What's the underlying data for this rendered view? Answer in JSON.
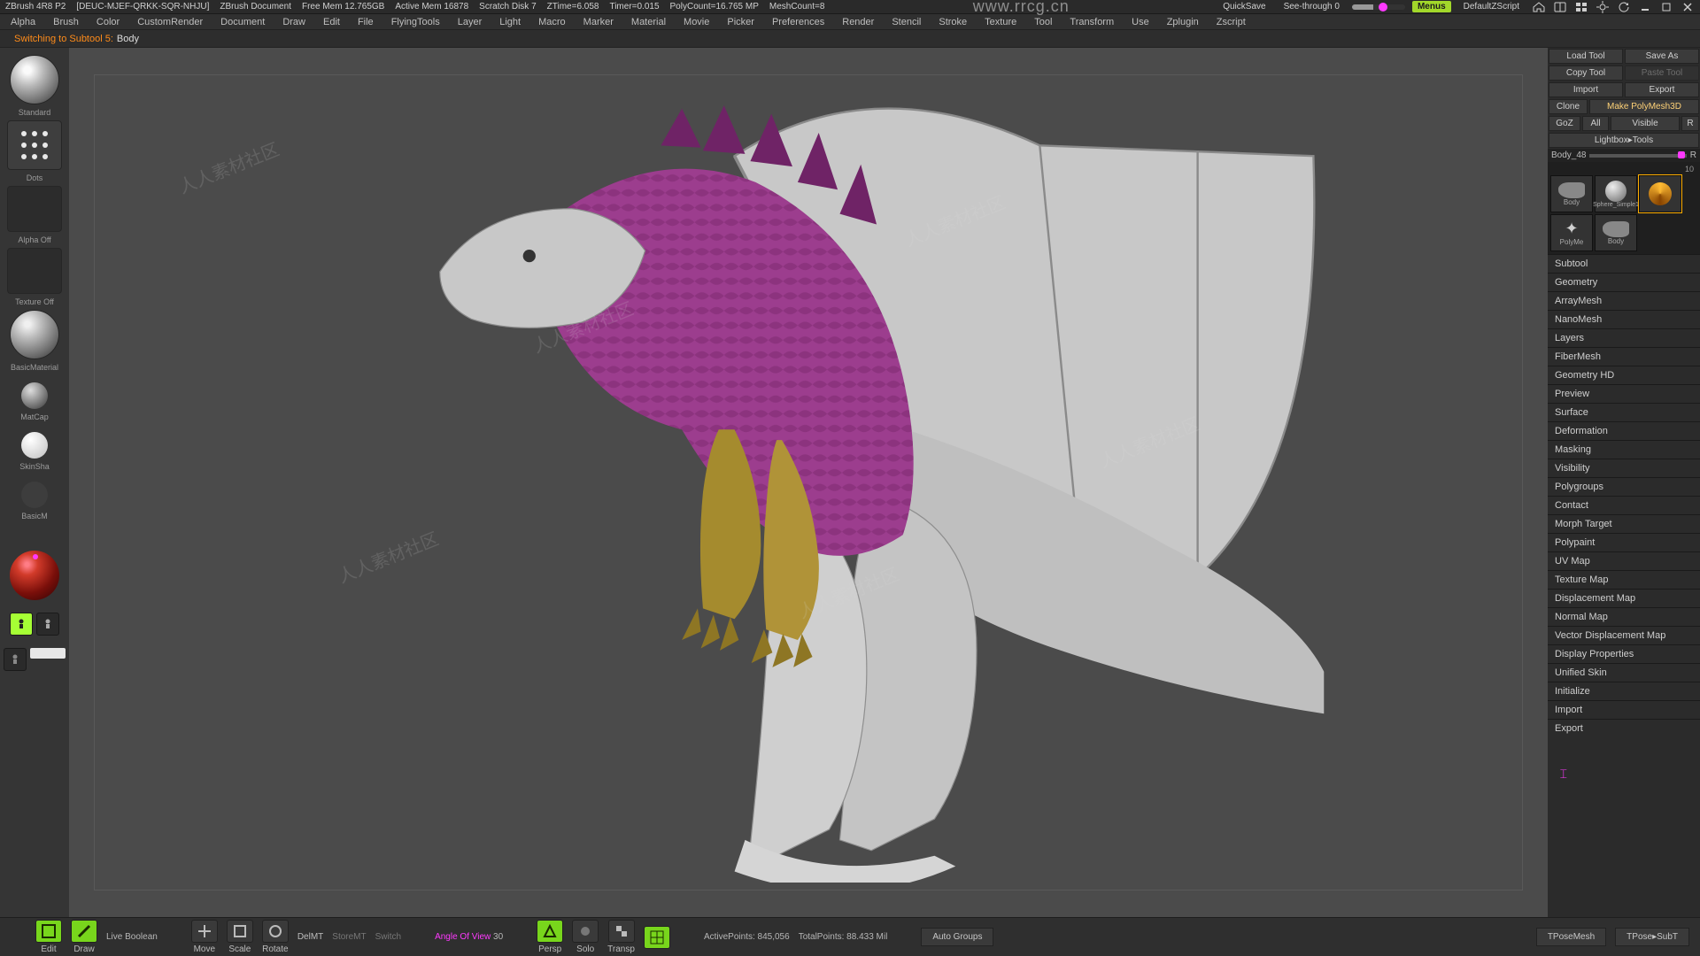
{
  "titlebar": {
    "app": "ZBrush 4R8 P2",
    "docid": "[DEUC-MJEF-QRKK-SQR-NHJU]",
    "doclabel": "ZBrush Document",
    "freemem": "Free Mem 12.765GB",
    "activemem": "Active Mem 16878",
    "scratch": "Scratch Disk 7",
    "ztime": "ZTime=6.058",
    "timer": "Timer=0.015",
    "polycount": "PolyCount=16.765 MP",
    "meshcount": "MeshCount=8",
    "watermark": "www.rrcg.cn",
    "quicksave": "QuickSave",
    "seethrough": "See-through  0",
    "menus": "Menus",
    "defaultz": "DefaultZScript"
  },
  "menus": {
    "items": [
      "Alpha",
      "Brush",
      "Color",
      "CustomRender",
      "Document",
      "Draw",
      "Edit",
      "File",
      "FlyingTools",
      "Layer",
      "Light",
      "Macro",
      "Marker",
      "Material",
      "Movie",
      "Picker",
      "Preferences",
      "Render",
      "Stencil",
      "Stroke",
      "Texture",
      "Tool",
      "Transform",
      "Use",
      "Zplugin",
      "Zscript"
    ]
  },
  "inforow": {
    "label": "Switching to Subtool 5:",
    "value": "Body"
  },
  "leftbar": {
    "brush_label": "Standard",
    "stroke_label": "Dots",
    "alpha_label": "Alpha Off",
    "texture_label": "Texture Off",
    "material_label": "BasicMaterial",
    "matcap": "MatCap",
    "skin": "SkinSha",
    "basic": "BasicM"
  },
  "rightpanel": {
    "loadtool": "Load Tool",
    "saveas": "Save As",
    "copytool": "Copy Tool",
    "pastetool": "Paste Tool",
    "import": "Import",
    "export": "Export",
    "clone": "Clone",
    "makepoly": "Make PolyMesh3D",
    "goz": "GoZ",
    "all": "All",
    "visible": "Visible",
    "r": "R",
    "lightbox": "Lightbox▸Tools",
    "subtool": "Body_48",
    "subtool_r": "R",
    "count": "10",
    "tt_labels": [
      "Body",
      "Sphere_Simple1",
      "",
      "PolyMe",
      "Body"
    ],
    "sections": [
      "Subtool",
      "Geometry",
      "ArrayMesh",
      "NanoMesh",
      "Layers",
      "FiberMesh",
      "Geometry HD",
      "Preview",
      "Surface",
      "Deformation",
      "Masking",
      "Visibility",
      "Polygroups",
      "Contact",
      "Morph Target",
      "Polypaint",
      "UV Map",
      "Texture Map",
      "Displacement Map",
      "Normal Map",
      "Vector Displacement Map",
      "Display Properties",
      "Unified Skin",
      "Initialize",
      "Import",
      "Export"
    ]
  },
  "bottombar": {
    "edit": "Edit",
    "draw": "Draw",
    "liveboolean": "Live Boolean",
    "move": "Move",
    "scale": "Scale",
    "rotate": "Rotate",
    "delmt": "DelMT",
    "storemt": "StoreMT",
    "switch": "Switch",
    "fov_label": "Angle Of View",
    "fov_val": "30",
    "persp": "Persp",
    "solo": "Solo",
    "transp": "Transp",
    "activepoints_label": "ActivePoints",
    "activepoints_val": "845,056",
    "totalpoints_label": "TotalPoints",
    "totalpoints_val": "88.433 Mil",
    "autogroups": "Auto Groups",
    "tposemesh": "TPoseMesh",
    "tposesubt": "TPose▸SubT"
  },
  "watermark_text": "人人素材社区"
}
